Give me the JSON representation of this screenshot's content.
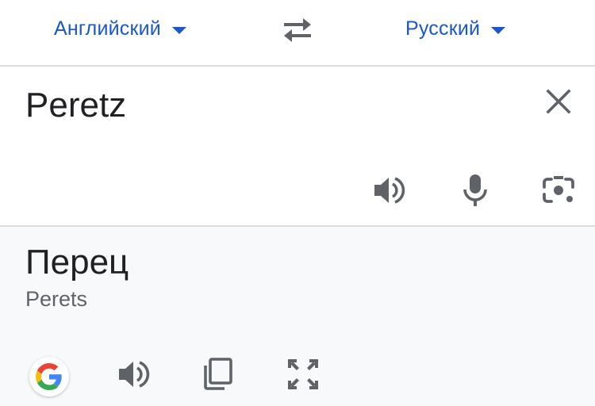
{
  "lang_bar": {
    "source_language": "Английский",
    "target_language": "Русский"
  },
  "input": {
    "text": "Peretz"
  },
  "output": {
    "translation": "Перец",
    "transliteration": "Perets"
  },
  "icons": {
    "swap": "swap-arrows-icon",
    "clear": "close-icon",
    "input_speaker": "speaker-icon",
    "mic": "microphone-icon",
    "camera": "camera-icon",
    "google": "google-logo-icon",
    "output_speaker": "speaker-icon",
    "copy": "copy-icon",
    "fullscreen": "fullscreen-icon"
  },
  "colors": {
    "accent": "#1a57c8",
    "icon": "#5f6368",
    "text": "#202124",
    "output_bg": "#f8f9fa",
    "divider": "#dadce0"
  }
}
